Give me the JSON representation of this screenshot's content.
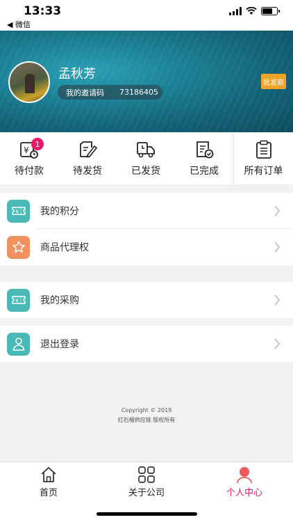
{
  "status": {
    "time": "13:33",
    "back_label": "◀ 微信"
  },
  "profile": {
    "name": "孟秋芳",
    "invite_label": "我的邀请码",
    "invite_code": "73186405",
    "badge": "批发商"
  },
  "orders": [
    {
      "label": "待付款",
      "icon": "wallet-clock-icon",
      "badge": "1"
    },
    {
      "label": "待发货",
      "icon": "document-pen-icon"
    },
    {
      "label": "已发货",
      "icon": "truck-clock-icon"
    },
    {
      "label": "已完成",
      "icon": "document-check-icon"
    },
    {
      "label": "所有订单",
      "icon": "clipboard-list-icon"
    }
  ],
  "menu": {
    "points": "我的积分",
    "agency": "商品代理权",
    "purchase": "我的采购",
    "logout": "退出登录"
  },
  "footer": {
    "copyright": "Copyright © 2019",
    "rights": "红石榴供应链 版权所有"
  },
  "tabs": [
    {
      "label": "首页",
      "icon": "home-icon"
    },
    {
      "label": "关于公司",
      "icon": "grid-icon"
    },
    {
      "label": "个人中心",
      "icon": "user-icon",
      "active": true
    }
  ],
  "colors": {
    "accent": "#e8196a",
    "teal": "#48b9b4",
    "orange": "#f19160",
    "badge": "#f0a229"
  }
}
